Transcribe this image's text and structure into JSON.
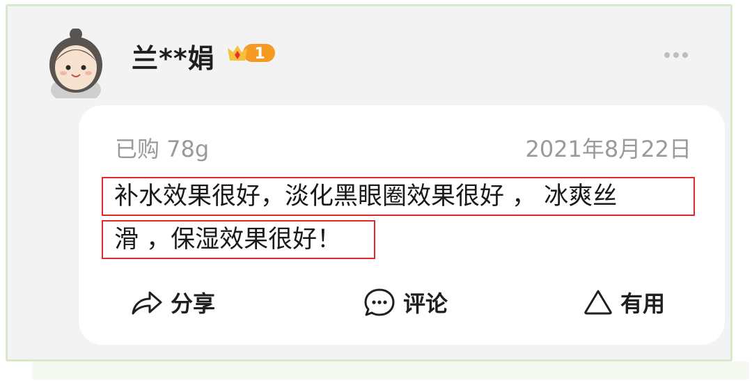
{
  "user": {
    "name": "兰**娟",
    "level_badge": "1"
  },
  "review": {
    "purchase_info": "已购 78g",
    "date": "2021年8月22日",
    "text_line1": "补水效果很好，淡化黑眼圈效果很好 ， 冰爽丝",
    "text_line2": "滑 ，保湿效果很好！"
  },
  "actions": {
    "share_label": "分享",
    "comment_label": "评论",
    "useful_label": "有用"
  },
  "colors": {
    "frame_border": "#d7e9c8",
    "highlight_box": "#e0292b",
    "badge_orange": "#f59a23"
  },
  "icons": [
    "avatar",
    "crown-badge-icon",
    "more-icon",
    "share-icon",
    "comment-icon",
    "useful-icon"
  ]
}
